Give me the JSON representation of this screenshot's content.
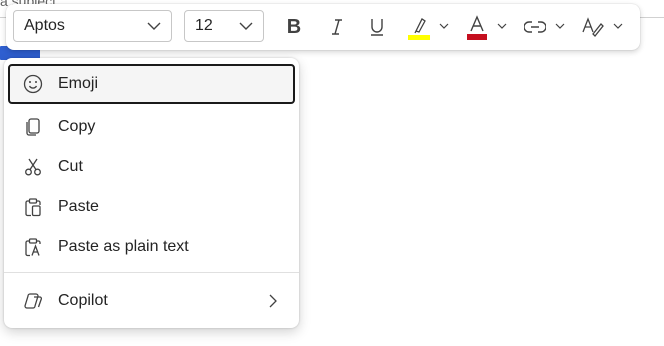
{
  "background": {
    "subject_text": "a subject"
  },
  "toolbar": {
    "font_family": "Aptos",
    "font_size": "12",
    "buttons": {
      "bold": "B",
      "highlight_color": "#ffff00",
      "font_color": "#c50f1f"
    }
  },
  "context_menu": {
    "items": [
      {
        "label": "Emoji",
        "icon": "emoji-icon"
      },
      {
        "label": "Copy",
        "icon": "copy-icon"
      },
      {
        "label": "Cut",
        "icon": "cut-icon"
      },
      {
        "label": "Paste",
        "icon": "paste-icon"
      },
      {
        "label": "Paste as plain text",
        "icon": "paste-plain-text-icon"
      },
      {
        "label": "Copilot",
        "icon": "copilot-icon"
      }
    ]
  }
}
